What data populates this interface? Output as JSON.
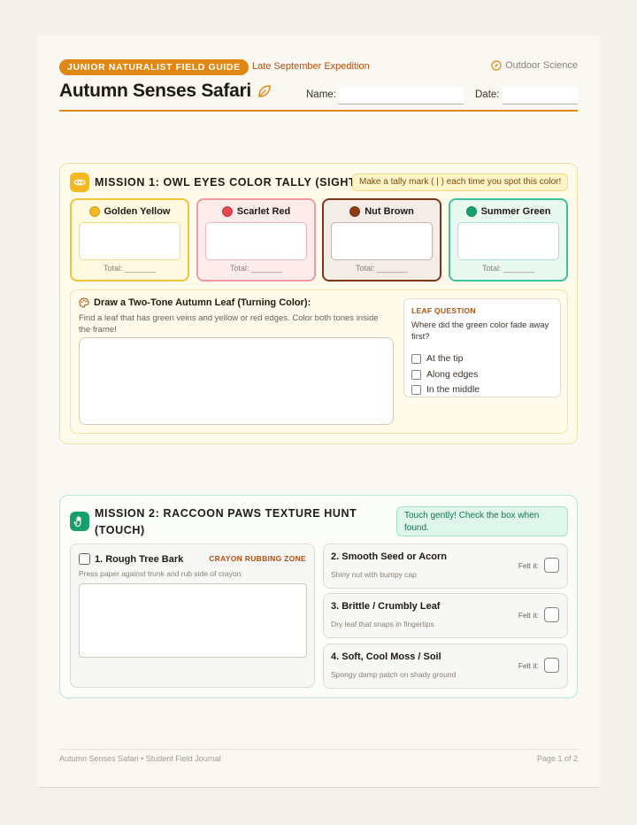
{
  "header": {
    "guide_label": "JUNIOR NATURALIST FIELD GUIDE",
    "expedition": "Late September Expedition",
    "subject": "Outdoor Science",
    "subject_icon": "compass-icon",
    "title": "Autumn Senses Safari",
    "title_icon": "leaf-icon",
    "name_label": "Name:",
    "name_value": "",
    "date_label": "Date:",
    "date_value": ""
  },
  "mission1": {
    "icon": "eye-icon",
    "title": "MISSION 1: OWL EYES COLOR TALLY (SIGHT)",
    "note": "Make a tally mark ( | ) each time you spot this color!",
    "colors": [
      {
        "name": "Golden Yellow",
        "swatch": "#f5b823",
        "border": "#f0c338",
        "bg": "#fff9e0",
        "total": "Total: _______"
      },
      {
        "name": "Scarlet Red",
        "swatch": "#e5474b",
        "border": "#ef9aa0",
        "bg": "#fdeceb",
        "total": "Total: _______"
      },
      {
        "name": "Nut Brown",
        "swatch": "#8b3c14",
        "border": "#7a3818",
        "bg": "#f4ece6",
        "total": "Total: _______"
      },
      {
        "name": "Summer Green",
        "swatch": "#18a06b",
        "border": "#3cc39b",
        "bg": "#eaf8f2",
        "total": "Total: _______"
      }
    ],
    "leaf_task": {
      "icon": "palette-icon",
      "title": "Draw a Two-Tone Autumn Leaf (Turning Color):",
      "description": "Find a leaf that has green veins and yellow or red edges. Color both tones inside the frame!"
    },
    "question": {
      "heading": "LEAF QUESTION",
      "text": "Where did the green color fade away first?",
      "options": [
        "At the tip",
        "Along edges",
        "In the middle"
      ]
    }
  },
  "mission2": {
    "icon": "hand-icon",
    "title_line1": "MISSION 2: RACCOON PAWS TEXTURE HUNT",
    "title_line2": "(TOUCH)",
    "note": "Touch gently! Check the box when found.",
    "bark": {
      "title": "1. Rough Tree Bark",
      "zone": "CRAYON RUBBING ZONE",
      "description": "Press paper against trunk and rub side of crayon:"
    },
    "textures": [
      {
        "title": "2. Smooth Seed or Acorn",
        "description": "Shiny nut with bumpy cap",
        "felt": "Felt it:"
      },
      {
        "title": "3. Brittle / Crumbly Leaf",
        "description": "Dry leaf that snaps in fingertips",
        "felt": "Felt it:"
      },
      {
        "title": "4. Soft, Cool Moss / Soil",
        "description": "Spongy damp patch on shady ground",
        "felt": "Felt it:"
      }
    ]
  },
  "footer": {
    "left": "Autumn Senses Safari • Student Field Journal",
    "right": "Page 1 of 2"
  },
  "colors": {
    "accent_orange": "#e08712",
    "accent_rust": "#b3500f",
    "mission2_green": "#18a06b"
  }
}
